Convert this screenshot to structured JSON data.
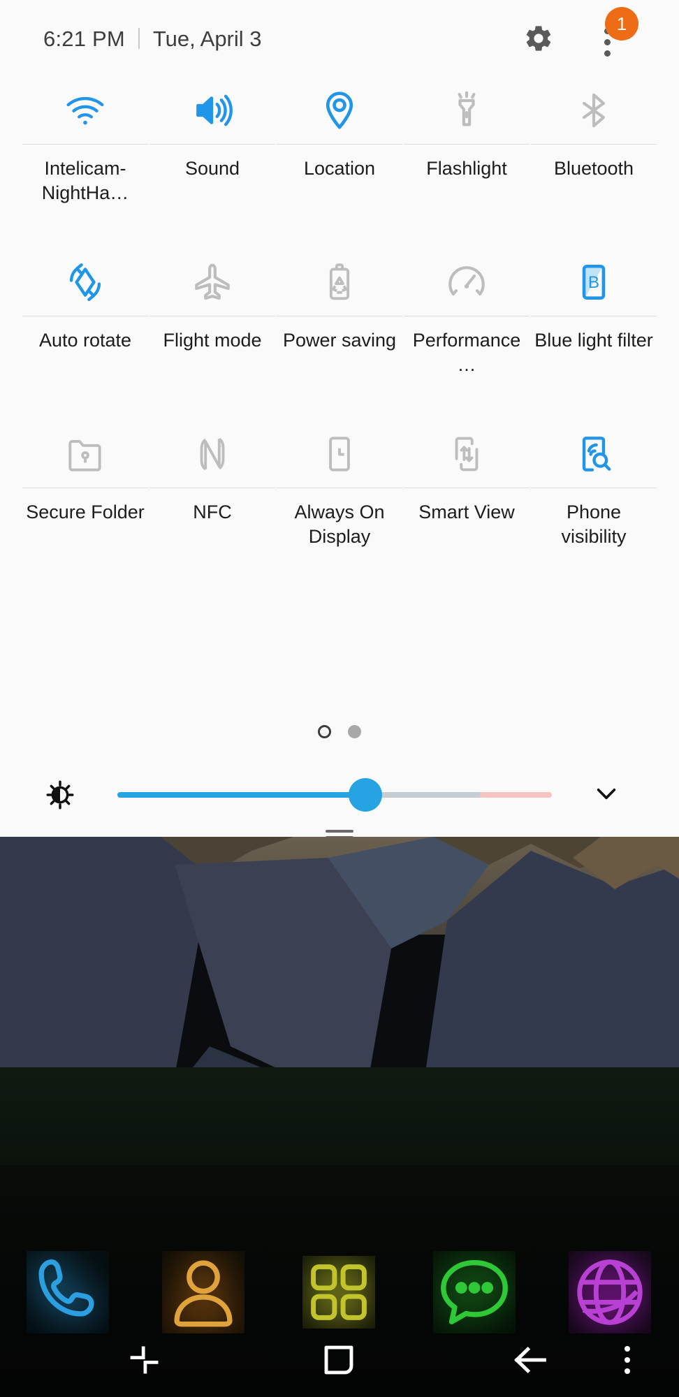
{
  "status_bar": {
    "time": "6:21 PM",
    "date": "Tue, April 3",
    "settings_icon": "gear-icon",
    "overflow_icon": "three-dots-vertical-icon",
    "notification_badge_count": "1",
    "badge_color": "#ef6c16"
  },
  "quick_settings": {
    "accent_on_color": "#2196e8",
    "off_color": "#bdbdbd",
    "rows": [
      {
        "tiles": [
          {
            "label": "Intelicam-NightHa…",
            "icon": "wifi-icon",
            "state": "on"
          },
          {
            "label": "Sound",
            "icon": "sound-icon",
            "state": "on"
          },
          {
            "label": "Location",
            "icon": "location-pin-icon",
            "state": "on"
          },
          {
            "label": "Flashlight",
            "icon": "flashlight-icon",
            "state": "off"
          },
          {
            "label": "Bluetooth",
            "icon": "bluetooth-icon",
            "state": "off"
          }
        ]
      },
      {
        "tiles": [
          {
            "label": "Auto rotate",
            "icon": "auto-rotate-icon",
            "state": "on"
          },
          {
            "label": "Flight mode",
            "icon": "airplane-icon",
            "state": "off"
          },
          {
            "label": "Power saving",
            "icon": "battery-recycle-icon",
            "state": "off"
          },
          {
            "label": "Performance…",
            "icon": "speedometer-icon",
            "state": "off"
          },
          {
            "label": "Blue light filter",
            "icon": "blue-light-filter-icon",
            "state": "on"
          }
        ]
      },
      {
        "tiles": [
          {
            "label": "Secure Folder",
            "icon": "secure-folder-icon",
            "state": "off"
          },
          {
            "label": "NFC",
            "icon": "nfc-icon",
            "state": "off"
          },
          {
            "label": "Always On Display",
            "icon": "always-on-display-icon",
            "state": "off"
          },
          {
            "label": "Smart View",
            "icon": "smart-view-icon",
            "state": "off"
          },
          {
            "label": "Phone visibility",
            "icon": "phone-visibility-icon",
            "state": "on"
          }
        ]
      }
    ],
    "pagination": {
      "total_pages": 2,
      "current_page": 1
    },
    "brightness": {
      "icon": "brightness-sun-icon",
      "value_percent": 57,
      "expand_icon": "chevron-down-icon",
      "track_color": "#25a3e3",
      "warn_color": "#f6c3c3"
    },
    "panel_handle": "drag-handle"
  },
  "home_screen": {
    "dock": [
      {
        "label": "Phone",
        "icon": "phone-handset-icon",
        "glow": "#2b9fe0"
      },
      {
        "label": "Contacts",
        "icon": "contacts-person-icon",
        "glow": "#e08a1e"
      },
      {
        "label": "Apps",
        "icon": "apps-grid-icon",
        "glow": "#b9bf2a"
      },
      {
        "label": "Messages",
        "icon": "message-bubble-icon",
        "glow": "#24b02c"
      },
      {
        "label": "Internet",
        "icon": "globe-browser-icon",
        "glow": "#a81fc0"
      }
    ],
    "nav_bar": [
      {
        "label": "Recents",
        "icon": "recents-icon"
      },
      {
        "label": "Home",
        "icon": "home-square-icon"
      },
      {
        "label": "Back",
        "icon": "back-arrow-icon"
      },
      {
        "label": "More",
        "icon": "three-dots-vertical-icon"
      }
    ]
  }
}
